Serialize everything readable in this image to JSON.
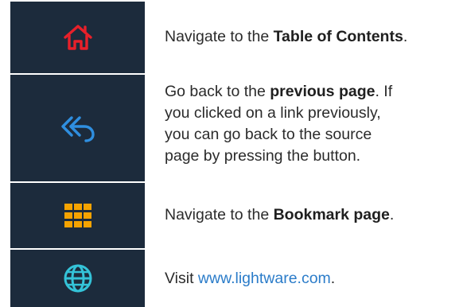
{
  "colors": {
    "tile_bg": "#1c2b3c",
    "home_icon": "#e8202a",
    "back_icon": "#2f8fe0",
    "bookmark_icon": "#f5a300",
    "web_icon": "#34c3d8",
    "link": "#2b7cc9"
  },
  "rows": [
    {
      "icon": "home-icon",
      "text_before": "Navigate to the ",
      "text_bold": "Table of Contents",
      "text_after": "."
    },
    {
      "icon": "back-icon",
      "line1_before": "Go back to the ",
      "line1_bold": "previous page",
      "line1_after": ". If",
      "line2": "you clicked on a link previously,",
      "line3": "you can go back to the source",
      "line4": "page by pressing the button."
    },
    {
      "icon": "bookmark-grid-icon",
      "text_before": "Navigate to the ",
      "text_bold": "Bookmark page",
      "text_after": "."
    },
    {
      "icon": "globe-icon",
      "text_before": "Visit ",
      "link_text": "www.lightware.com",
      "text_after": "."
    }
  ]
}
